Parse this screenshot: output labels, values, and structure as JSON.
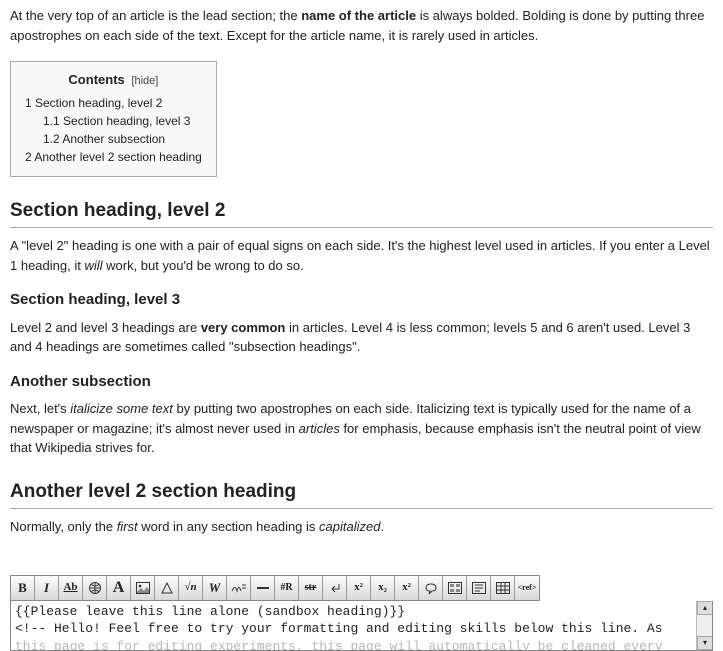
{
  "lead": {
    "part1": "At the very top of an article is the lead section; the ",
    "bold1": "name of the article",
    "part2": " is always bolded. Bolding is done by putting three apostrophes on each side of the text. Except for the article name, it is rarely used in articles."
  },
  "toc": {
    "title": "Contents",
    "hide": "[hide]",
    "items": [
      {
        "num": "1",
        "label": "Section heading, level 2",
        "cls": ""
      },
      {
        "num": "1.1",
        "label": "Section heading, level 3",
        "cls": "toc-sub"
      },
      {
        "num": "1.2",
        "label": "Another subsection",
        "cls": "toc-sub"
      },
      {
        "num": "2",
        "label": "Another level 2 section heading",
        "cls": ""
      }
    ]
  },
  "s1": {
    "heading": "Section heading, level 2",
    "p1a": "A \"level 2\" heading is one with a pair of equal signs on each side. It's the highest level used in articles. If you enter a Level 1 heading, it ",
    "p1will": "will",
    "p1b": " work, but you'd be wrong to do so."
  },
  "s2": {
    "heading": "Section heading, level 3",
    "p1a": "Level 2 and level 3 headings are ",
    "bold": "very common",
    "p1b": " in articles. Level 4 is less common; levels 5 and 6 aren't used. Level 3 and 4 headings are sometimes called \"subsection headings\"."
  },
  "s3": {
    "heading": "Another subsection",
    "p1a": "Next, let's ",
    "ital": "italicize some text",
    "p1b": " by putting two apostrophes on each side. Italicizing text is typically used for the name of a newspaper or magazine; it's almost never used in ",
    "ital2": "articles",
    "p1c": " for emphasis, because emphasis isn't the neutral point of view that Wikipedia strives for."
  },
  "s4": {
    "heading": "Another level 2 section heading",
    "p1a": "Normally, only the ",
    "ital": "first",
    "p1b": " word in any section heading is ",
    "ital2": "capitalized",
    "p1c": "."
  },
  "toolbar": {
    "bold": "B",
    "italic": "I",
    "ab": "Ab",
    "bigA": "A",
    "sqrt": "√n",
    "W": "W",
    "hashR": "#R",
    "str": "str",
    "sup": "x²",
    "sub": "x₂",
    "ref": "<ref>"
  },
  "editor": {
    "line1": "{{Please leave this line alone (sandbox heading)}}",
    "line2": "<!-- Hello! Feel free to try your formatting and editing skills below this line. As",
    "line3": "this page is for editing experiments, this page will automatically be cleaned every"
  },
  "scroll": {
    "up": "▴",
    "down": "▾"
  }
}
